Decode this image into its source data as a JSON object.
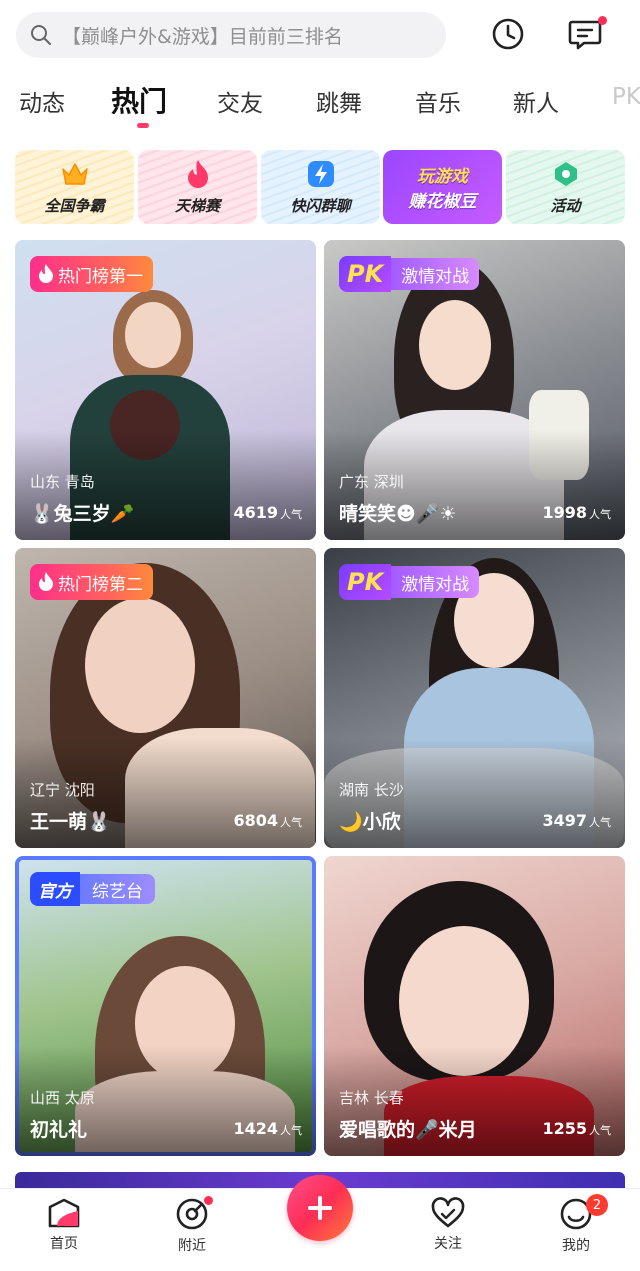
{
  "search": {
    "placeholder": "【巅峰户外&游戏】目前前三排名"
  },
  "header": {
    "history_icon": "clock-icon",
    "message_icon": "message-icon"
  },
  "tabs": [
    {
      "label": "动态"
    },
    {
      "label": "热门",
      "active": true
    },
    {
      "label": "交友"
    },
    {
      "label": "跳舞"
    },
    {
      "label": "音乐"
    },
    {
      "label": "新人"
    },
    {
      "label": "PK"
    }
  ],
  "features": [
    {
      "label": "全国争霸",
      "icon": "crown-icon"
    },
    {
      "label": "天梯赛",
      "icon": "flame-icon"
    },
    {
      "label": "快闪群聊",
      "icon": "lightning-icon"
    },
    {
      "line1": "玩游戏",
      "line2": "赚花椒豆"
    },
    {
      "label": "活动",
      "icon": "location-tag-icon"
    }
  ],
  "cards": [
    {
      "badge": "热门榜第一",
      "location": "山东 青岛",
      "name": "🐰兔三岁🥕",
      "popularity": "4619",
      "unit": "人气"
    },
    {
      "badge_pk": "PK",
      "badge": "激情对战",
      "location": "广东 深圳",
      "name": "晴笑笑☻🎤☀",
      "popularity": "1998",
      "unit": "人气"
    },
    {
      "badge": "热门榜第二",
      "location": "辽宁 沈阳",
      "name": "王一萌🐰",
      "popularity": "6804",
      "unit": "人气"
    },
    {
      "badge_pk": "PK",
      "badge": "激情对战",
      "location": "湖南 长沙",
      "name": "🌙小欣",
      "popularity": "3497",
      "unit": "人气"
    },
    {
      "badge_official": "官方",
      "badge": "综艺台",
      "location": "山西 太原",
      "name": "初礼礼",
      "popularity": "1424",
      "unit": "人气"
    },
    {
      "location": "吉林 长春",
      "name": "爱唱歌的🎤米月",
      "popularity": "1255",
      "unit": "人气"
    }
  ],
  "bottom_nav": [
    {
      "label": "首页",
      "icon": "home-icon"
    },
    {
      "label": "附近",
      "icon": "nearby-icon"
    },
    {
      "label": "",
      "icon": "plus-icon"
    },
    {
      "label": "关注",
      "icon": "heart-icon"
    },
    {
      "label": "我的",
      "icon": "profile-icon",
      "badge": "2"
    }
  ],
  "colors": {
    "accent": "#ff2d55",
    "tab_indicator": "#ff3b6b"
  }
}
